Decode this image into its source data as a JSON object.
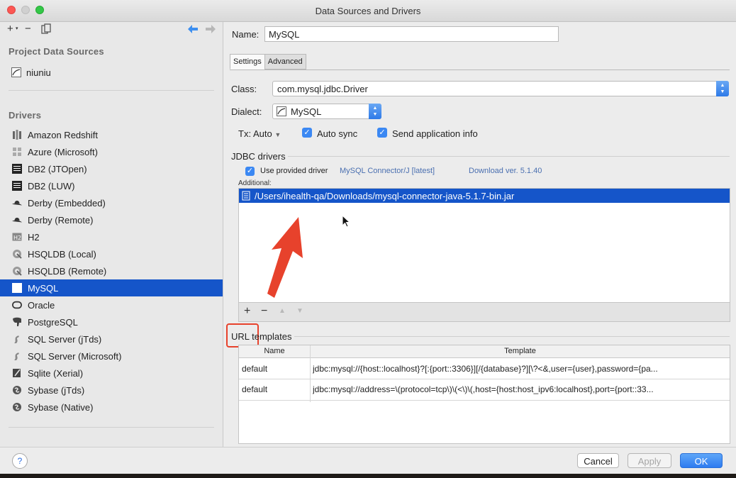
{
  "window": {
    "title": "Data Sources and Drivers"
  },
  "left_toolbar": {
    "add": "+",
    "remove": "−"
  },
  "project_sources": {
    "heading": "Project Data Sources",
    "items": [
      {
        "label": "niuniu"
      }
    ]
  },
  "drivers": {
    "heading": "Drivers",
    "selected_index": 9,
    "items": [
      {
        "label": "Amazon Redshift",
        "icon": "bars-icon"
      },
      {
        "label": "Azure (Microsoft)",
        "icon": "windows-icon"
      },
      {
        "label": "DB2 (JTOpen)",
        "icon": "ibm-icon"
      },
      {
        "label": "DB2 (LUW)",
        "icon": "ibm-icon"
      },
      {
        "label": "Derby (Embedded)",
        "icon": "hat-icon"
      },
      {
        "label": "Derby (Remote)",
        "icon": "hat-icon"
      },
      {
        "label": "H2",
        "icon": "h2-icon"
      },
      {
        "label": "HSQLDB (Local)",
        "icon": "hsql-icon"
      },
      {
        "label": "HSQLDB (Remote)",
        "icon": "hsql-icon"
      },
      {
        "label": "MySQL",
        "icon": "mysql-icon"
      },
      {
        "label": "Oracle",
        "icon": "oracle-icon"
      },
      {
        "label": "PostgreSQL",
        "icon": "elephant-icon"
      },
      {
        "label": "SQL Server (jTds)",
        "icon": "sqlserver-icon"
      },
      {
        "label": "SQL Server (Microsoft)",
        "icon": "sqlserver-icon"
      },
      {
        "label": "Sqlite (Xerial)",
        "icon": "feather-icon"
      },
      {
        "label": "Sybase (jTds)",
        "icon": "sybase-icon"
      },
      {
        "label": "Sybase (Native)",
        "icon": "sybase-icon"
      }
    ]
  },
  "form": {
    "name_label": "Name:",
    "name_value": "MySQL",
    "tabs": [
      {
        "label": "Settings",
        "active": true
      },
      {
        "label": "Advanced",
        "active": false
      }
    ],
    "class_label": "Class:",
    "class_value": "com.mysql.jdbc.Driver",
    "dialect_label": "Dialect:",
    "dialect_value": "MySQL",
    "tx_label": "Tx: Auto",
    "auto_sync": {
      "label": "Auto sync",
      "checked": true
    },
    "send_app_info": {
      "label": "Send application info",
      "checked": true
    }
  },
  "jdbc": {
    "heading": "JDBC drivers",
    "use_provided": {
      "label": "Use provided driver",
      "checked": true
    },
    "provided_driver": "MySQL Connector/J [latest]",
    "download_link": "Download ver. 5.1.40",
    "additional_label": "Additional:",
    "files": [
      "/Users/ihealth-qa/Downloads/mysql-connector-java-5.1.7-bin.jar"
    ],
    "toolbar": {
      "add": "+",
      "remove": "−",
      "up": "▲",
      "down": "▼"
    }
  },
  "url_templates": {
    "heading": "URL templates",
    "columns": [
      "Name",
      "Template"
    ],
    "rows": [
      {
        "name": "default",
        "template": "jdbc:mysql://{host::localhost}?[:{port::3306}][/{database}?][\\?<&,user={user},password={pa..."
      },
      {
        "name": "default",
        "template": "jdbc:mysql://address=\\(protocol=tcp\\)\\(<\\)\\(,host={host:host_ipv6:localhost},port={port::33..."
      }
    ]
  },
  "buttons": {
    "help": "?",
    "cancel": "Cancel",
    "apply": "Apply",
    "ok": "OK"
  },
  "colors": {
    "selection": "#1555c9",
    "accent": "#3b88f3",
    "annotation": "#e7422c"
  }
}
